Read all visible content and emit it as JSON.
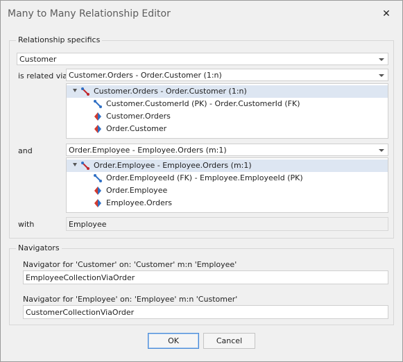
{
  "window": {
    "title": "Many to Many Relationship Editor",
    "close_symbol": "✕"
  },
  "specifics": {
    "legend": "Relationship specifics",
    "entity": "Customer",
    "is_related_via_label": "is related via",
    "relation1": {
      "selected": "Customer.Orders - Order.Customer (1:n)",
      "tree": {
        "root": "Customer.Orders - Order.Customer (1:n)",
        "children": [
          "Customer.CustomerId (PK) - Order.CustomerId (FK)",
          "Customer.Orders",
          "Order.Customer"
        ]
      }
    },
    "and_label": "and",
    "relation2": {
      "selected": "Order.Employee - Employee.Orders (m:1)",
      "tree": {
        "root": "Order.Employee - Employee.Orders (m:1)",
        "children": [
          "Order.EmployeeId (FK) - Employee.EmployeeId (PK)",
          "Order.Employee",
          "Employee.Orders"
        ]
      }
    },
    "with_label": "with",
    "with_value": "Employee"
  },
  "navigators": {
    "legend": "Navigators",
    "nav1_label": "Navigator for 'Customer' on: 'Customer'  m:n  'Employee'",
    "nav1_value": "EmployeeCollectionViaOrder",
    "nav2_label": "Navigator for 'Employee' on: 'Employee'  m:n  'Customer'",
    "nav2_value": "CustomerCollectionViaOrder"
  },
  "buttons": {
    "ok": "OK",
    "cancel": "Cancel"
  },
  "colors": {
    "relation_icon": "#c0262c",
    "field_icon": "#2f6fc4",
    "navigator_left": "#d33a2e",
    "navigator_right": "#2f6fc4"
  }
}
